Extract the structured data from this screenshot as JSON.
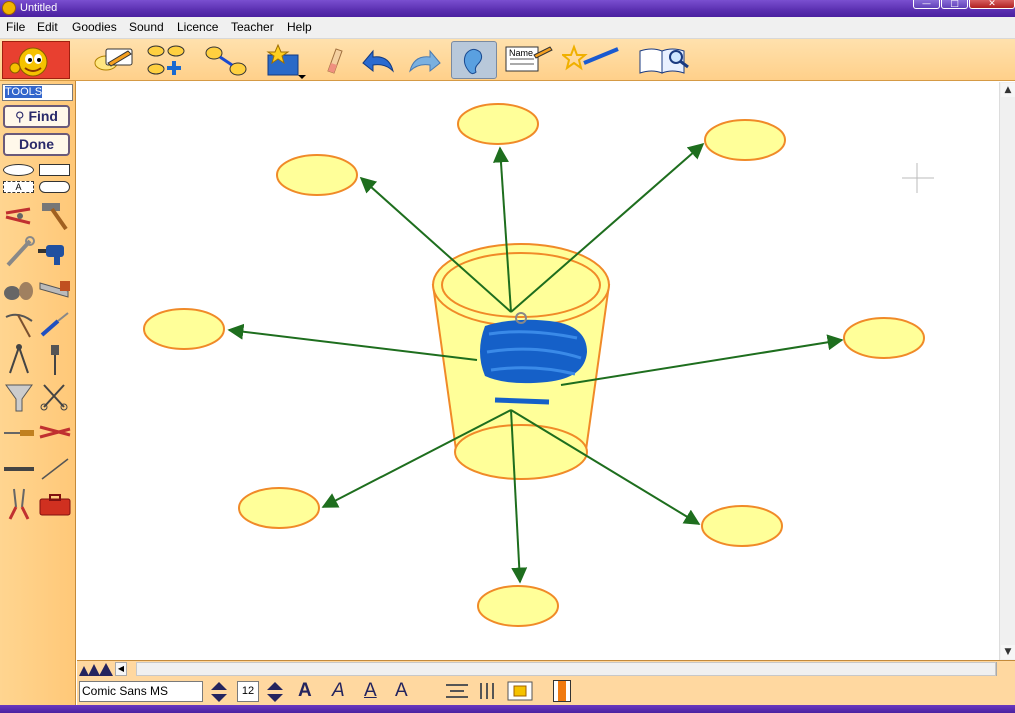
{
  "window": {
    "title": "Untitled"
  },
  "menu": [
    "File",
    "Edit",
    "Goodies",
    "Sound",
    "Licence",
    "Teacher",
    "Help"
  ],
  "toolbar": {
    "tools": [
      {
        "icon": "rapidfire-pencil-icon"
      },
      {
        "icon": "add-symbol-icon"
      },
      {
        "icon": "link-icon"
      },
      {
        "icon": "symbol-library-icon"
      },
      {
        "icon": "eraser-icon"
      },
      {
        "icon": "undo-icon"
      },
      {
        "icon": "redo-icon"
      },
      {
        "icon": "listen-ear-icon",
        "pressed": true
      },
      {
        "icon": "name-tag-icon",
        "label": "Name"
      },
      {
        "icon": "magic-wand-icon"
      },
      {
        "icon": "book-magnifier-icon"
      }
    ]
  },
  "left_panel": {
    "search_field": "TOOLS",
    "find_label": "Find",
    "done_label": "Done",
    "text_tool_label": "A",
    "library_items": [
      "pliers-icon",
      "hammer-icon",
      "wrench-icon",
      "blue-drill-icon",
      "stones-icon",
      "saw-icon",
      "pickaxe-icon",
      "screwdriver-icon",
      "compass-icon",
      "awl-icon",
      "funnel-icon",
      "scissors-icon",
      "chisel-icon",
      "bolt-cutter-icon",
      "file-icon",
      "needle-icon",
      "wire-cutter-icon",
      "red-toolbox-icon"
    ]
  },
  "diagram": {
    "center_symbol": "bucket",
    "colors": {
      "node_fill": "#ffff99",
      "node_border": "#f08a28",
      "link": "#1e6e1e",
      "scribble": "#1560c8"
    },
    "nodes": [
      {
        "id": "top",
        "text": ""
      },
      {
        "id": "upper-left",
        "text": ""
      },
      {
        "id": "upper-right",
        "text": ""
      },
      {
        "id": "left",
        "text": ""
      },
      {
        "id": "right",
        "text": ""
      },
      {
        "id": "lower-left",
        "text": ""
      },
      {
        "id": "lower-right",
        "text": ""
      },
      {
        "id": "bottom",
        "text": ""
      }
    ]
  },
  "font_bar": {
    "font_name": "Comic Sans MS",
    "font_size": "12",
    "bold_label": "A",
    "italic_label": "A",
    "underline_label": "A",
    "color_label": "A"
  },
  "colors": {
    "panel_orange": "#ffd08a",
    "title_purple": "#5a2fb0",
    "menu_bg": "#f0f0f0"
  }
}
